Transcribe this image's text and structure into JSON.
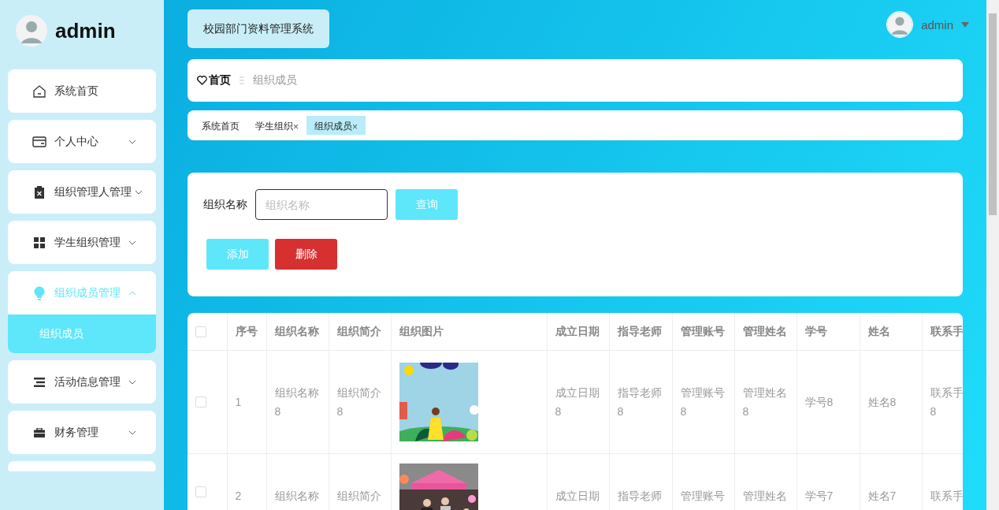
{
  "sidebar": {
    "user": "admin",
    "menu": [
      {
        "label": "系统首页",
        "kind": "link",
        "expanded": false
      },
      {
        "label": "个人中心",
        "kind": "submenu",
        "expanded": false
      },
      {
        "label": "组织管理人管理",
        "kind": "submenu",
        "expanded": false
      },
      {
        "label": "学生组织管理",
        "kind": "submenu",
        "expanded": false
      },
      {
        "label": "组织成员管理",
        "kind": "submenu",
        "expanded": true,
        "children": [
          {
            "label": "组织成员",
            "selected": true
          }
        ]
      },
      {
        "label": "活动信息管理",
        "kind": "submenu",
        "expanded": false
      },
      {
        "label": "财务管理",
        "kind": "submenu",
        "expanded": false
      }
    ]
  },
  "header": {
    "title": "校园部门资料管理系统",
    "user": "admin"
  },
  "breadcrumb": [
    {
      "label": "首页"
    },
    {
      "label": "组织成员"
    }
  ],
  "tags": [
    {
      "label": "系统首页",
      "selected": false
    },
    {
      "label": "学生组织",
      "close": "×",
      "selected": false
    },
    {
      "label": "组织成员",
      "close": "×",
      "selected": true
    }
  ],
  "search": {
    "label": "组织名称",
    "placeholder": "组织名称",
    "button": {
      "label": "查询",
      "kind": "primary"
    }
  },
  "actions": [
    {
      "label": "添加",
      "kind": "primary"
    },
    {
      "label": "删除",
      "kind": "danger"
    }
  ],
  "table": {
    "all_checked": false,
    "columns": [
      "序号",
      "组织名称",
      "组织简介",
      "组织图片",
      "成立日期",
      "指导老师",
      "管理账号",
      "管理姓名",
      "学号",
      "姓名",
      "联系手"
    ],
    "rows": [
      {
        "checked": false,
        "cells": [
          "1",
          "组织名称8",
          "组织简介8",
          {
            "kind": "picture"
          },
          "成立日期8",
          "指导老师8",
          "管理账号8",
          "管理姓名8",
          "学号8",
          "姓名8",
          "联系手8"
        ]
      },
      {
        "checked": false,
        "cells": [
          "2",
          "组织名称",
          "组织简介",
          {
            "kind": "picture"
          },
          "成立日期",
          "指导老师",
          "管理账号",
          "管理姓名",
          "学号7",
          "姓名7",
          "联系手"
        ]
      }
    ]
  }
}
